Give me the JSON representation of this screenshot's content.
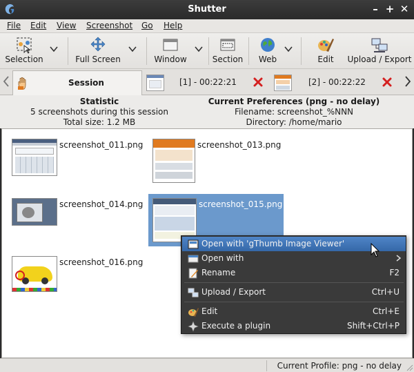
{
  "window": {
    "title": "Shutter"
  },
  "menubar": {
    "items": [
      "File",
      "Edit",
      "View",
      "Screenshot",
      "Go",
      "Help"
    ]
  },
  "toolbar": {
    "selection": "Selection",
    "full_screen": "Full Screen",
    "window": "Window",
    "section": "Section",
    "web": "Web",
    "edit": "Edit",
    "upload_export": "Upload / Export"
  },
  "tabs": {
    "session": "Session",
    "tab1": "[1] - 00:22:21",
    "tab2": "[2] - 00:22:22"
  },
  "info": {
    "statistic_title": "Statistic",
    "statistic_count": "5 screenshots during this session",
    "statistic_size": "Total size: 1.2 MB",
    "prefs_title": "Current Preferences (png - no delay)",
    "prefs_filename": "Filename: screenshot_%NNN",
    "prefs_directory": "Directory: /home/mario"
  },
  "screenshots": [
    {
      "name": "screenshot_011.png"
    },
    {
      "name": "screenshot_013.png"
    },
    {
      "name": "screenshot_014.png"
    },
    {
      "name": "screenshot_015.png",
      "selected": true
    },
    {
      "name": "screenshot_016.png"
    }
  ],
  "context_menu": {
    "open_with_default": "Open with 'gThumb Image Viewer'",
    "open_with": "Open with",
    "rename": "Rename",
    "rename_shortcut": "F2",
    "upload_export": "Upload / Export",
    "upload_export_shortcut": "Ctrl+U",
    "edit": "Edit",
    "edit_shortcut": "Ctrl+E",
    "execute_plugin": "Execute a plugin",
    "execute_plugin_shortcut": "Shift+Ctrl+P"
  },
  "statusbar": {
    "profile": "Current Profile: png - no delay"
  },
  "colors": {
    "selection": "#6b99cc",
    "menu_highlight": "#3f74b5",
    "menu_bg": "#3a3a3a",
    "close_red": "#d42020"
  }
}
